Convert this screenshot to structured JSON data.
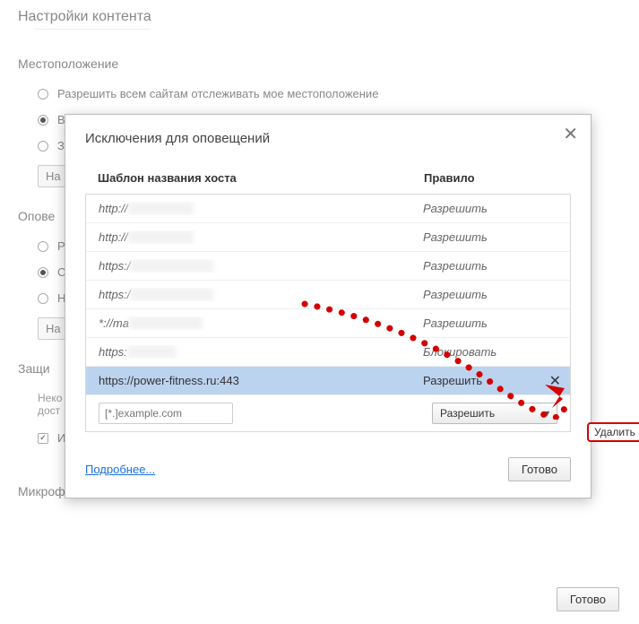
{
  "page": {
    "title": "Настройки контента",
    "location": {
      "heading": "Местоположение",
      "opt_allow_all": "Разрешить всем сайтам отслеживать мое местоположение",
      "opt_v": "В",
      "opt_z": "З",
      "manage_btn": "На"
    },
    "notices": {
      "heading": "Опове",
      "opt_r": "Р",
      "opt_c": "С",
      "opt_n": "Н",
      "manage_btn": "На"
    },
    "protected": {
      "heading": "Защи",
      "text1": "Неко",
      "text2": "дост",
      "opt_i": "И",
      "link": "Подробнее..."
    },
    "mic": {
      "heading": "Микрофон"
    },
    "done_btn": "Готово"
  },
  "modal": {
    "title": "Исключения для оповещений",
    "col_host": "Шаблон названия хоста",
    "col_rule": "Правило",
    "rows": [
      {
        "host_prefix": "http://",
        "host_rest": "████████",
        "rule": "Разрешить",
        "selected": false,
        "removable": false,
        "blurred": true
      },
      {
        "host_prefix": "http://",
        "host_rest": "████████",
        "rule": "Разрешить",
        "selected": false,
        "removable": false,
        "blurred": true
      },
      {
        "host_prefix": "https:/",
        "host_rest": "██████████",
        "rule": "Разрешить",
        "selected": false,
        "removable": false,
        "blurred": true
      },
      {
        "host_prefix": "https:/",
        "host_rest": "██████████",
        "rule": "Разрешить",
        "selected": false,
        "removable": false,
        "blurred": true
      },
      {
        "host_prefix": "*://ma",
        "host_rest": "████████ *",
        "rule": "Разрешить",
        "selected": false,
        "removable": false,
        "blurred": true
      },
      {
        "host_prefix": "https:",
        "host_rest": "██████",
        "rule": "Блокировать",
        "selected": false,
        "removable": false,
        "blurred": true
      },
      {
        "host_prefix": "https://power-fitness.ru:443",
        "host_rest": "",
        "rule": "Разрешить",
        "selected": true,
        "removable": true,
        "blurred": false
      }
    ],
    "input_placeholder": "[*.]example.com",
    "select_value": "Разрешить",
    "more_link": "Подробнее...",
    "done_btn": "Готово"
  },
  "annotation": {
    "label": "Удалить"
  }
}
